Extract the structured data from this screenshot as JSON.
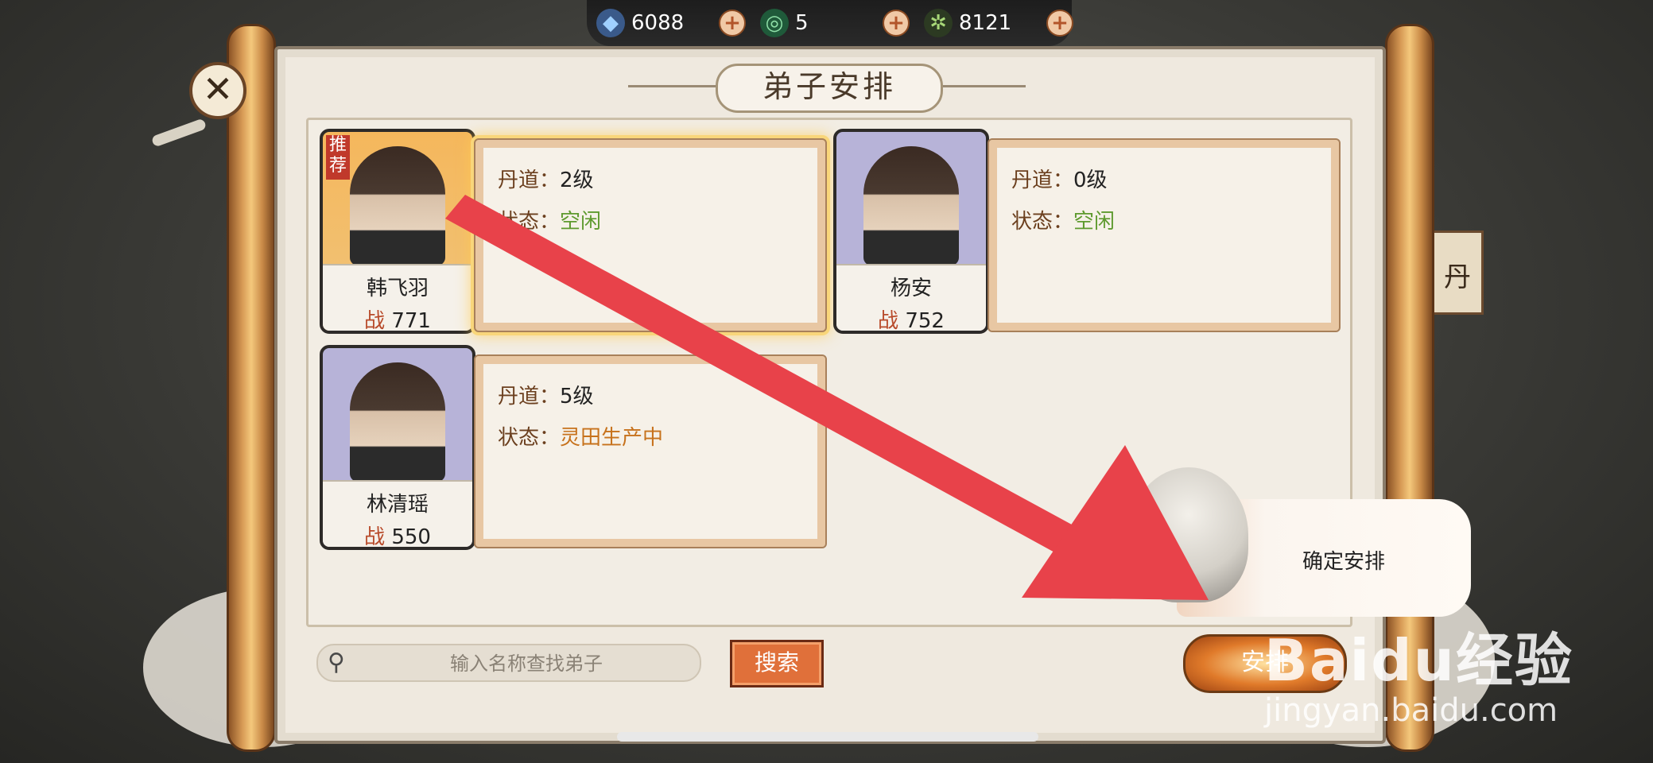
{
  "resources": [
    {
      "icon": "spirit-stone-icon",
      "value": "6088"
    },
    {
      "icon": "jade-coin-icon",
      "value": "5"
    },
    {
      "icon": "herb-icon",
      "value": "8121"
    }
  ],
  "dialog": {
    "title": "弟子安排"
  },
  "labels": {
    "dan_dao": "丹道：",
    "status": "状态：",
    "power_prefix": "战",
    "recommend_tag": "推荐"
  },
  "disciples": [
    {
      "name": "韩飞羽",
      "power": "771",
      "level": "2级",
      "status": "空闲",
      "recommended": true,
      "selected": true
    },
    {
      "name": "杨安",
      "power": "752",
      "level": "0级",
      "status": "空闲",
      "recommended": false,
      "selected": false
    },
    {
      "name": "林清瑶",
      "power": "550",
      "level": "5级",
      "status": "灵田生产中",
      "recommended": false,
      "selected": false
    }
  ],
  "search": {
    "placeholder": "输入名称查找弟子",
    "button": "搜索"
  },
  "arrange_button": "安排",
  "tooltip": "确定安排",
  "background": {
    "right_panel_char": "丹"
  },
  "watermark": {
    "brand": "Baidu经验",
    "url": "jingyan.baidu.com"
  },
  "colors": {
    "idle_status": "#5e9a2e",
    "busy_status": "#c7721c",
    "arrow": "#e8424a",
    "button_orange": "#e0703a"
  }
}
